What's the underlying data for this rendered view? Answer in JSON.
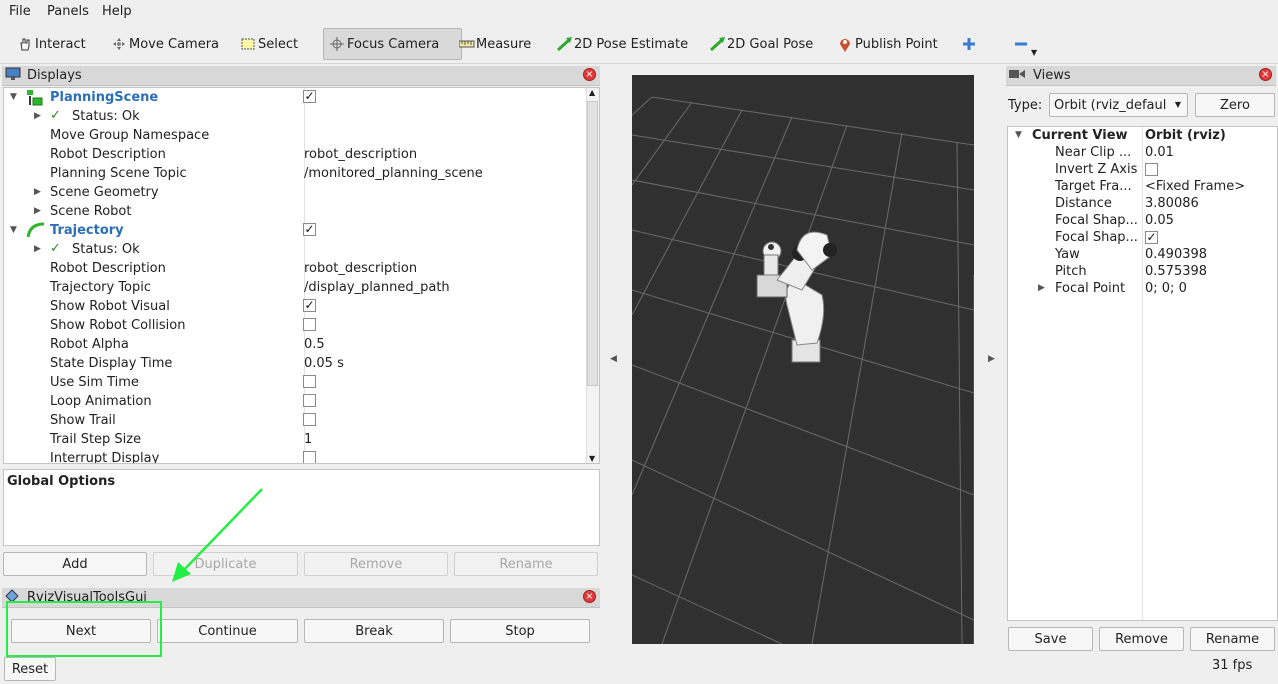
{
  "menu": {
    "file": "File",
    "panels": "Panels",
    "help": "Help"
  },
  "toolbar": {
    "interact": "Interact",
    "move_camera": "Move Camera",
    "select": "Select",
    "focus_camera": "Focus Camera",
    "measure": "Measure",
    "pose_estimate": "2D Pose Estimate",
    "goal_pose": "2D Goal Pose",
    "publish_point": "Publish Point"
  },
  "displays": {
    "title": "Displays",
    "rows": [
      {
        "name": "PlanningScene"
      },
      {
        "name": "Status: Ok"
      },
      {
        "name": "Move Group Namespace",
        "value": ""
      },
      {
        "name": "Robot Description",
        "value": "robot_description"
      },
      {
        "name": "Planning Scene Topic",
        "value": "/monitored_planning_scene"
      },
      {
        "name": "Scene Geometry"
      },
      {
        "name": "Scene Robot"
      },
      {
        "name": "Trajectory"
      },
      {
        "name": "Status: Ok"
      },
      {
        "name": "Robot Description",
        "value": "robot_description"
      },
      {
        "name": "Trajectory Topic",
        "value": "/display_planned_path"
      },
      {
        "name": "Show Robot Visual",
        "checked": true
      },
      {
        "name": "Show Robot Collision",
        "checked": false
      },
      {
        "name": "Robot Alpha",
        "value": "0.5"
      },
      {
        "name": "State Display Time",
        "value": "0.05 s"
      },
      {
        "name": "Use Sim Time",
        "checked": false
      },
      {
        "name": "Loop Animation",
        "checked": false
      },
      {
        "name": "Show Trail",
        "checked": false
      },
      {
        "name": "Trail Step Size",
        "value": "1"
      },
      {
        "name": "Interrupt Display",
        "checked": false
      }
    ],
    "global_options": "Global Options",
    "buttons": {
      "add": "Add",
      "duplicate": "Duplicate",
      "remove": "Remove",
      "rename": "Rename"
    }
  },
  "rviz_tools": {
    "title": "RvizVisualToolsGui",
    "next": "Next",
    "continue": "Continue",
    "break": "Break",
    "stop": "Stop"
  },
  "reset": "Reset",
  "views": {
    "title": "Views",
    "type_label": "Type:",
    "type_value": "Orbit (rviz_defaul",
    "zero": "Zero",
    "current_view": "Current View",
    "current_view_value": "Orbit (rviz)",
    "rows": [
      {
        "name": "Near Clip ...",
        "value": "0.01"
      },
      {
        "name": "Invert Z Axis",
        "checked": false
      },
      {
        "name": "Target Fra...",
        "value": "<Fixed Frame>"
      },
      {
        "name": "Distance",
        "value": "3.80086"
      },
      {
        "name": "Focal Shap...",
        "value": "0.05"
      },
      {
        "name": "Focal Shap...",
        "checked": true
      },
      {
        "name": "Yaw",
        "value": "0.490398"
      },
      {
        "name": "Pitch",
        "value": "0.575398"
      },
      {
        "name": "Focal Point",
        "value": "0; 0; 0"
      }
    ],
    "save": "Save",
    "remove": "Remove",
    "rename": "Rename"
  },
  "fps": "31 fps",
  "colors": {
    "annotation": "#22ee44",
    "link_blue": "#2b6fb6",
    "viewport_bg": "#303030",
    "close_red": "#e03a3a"
  }
}
